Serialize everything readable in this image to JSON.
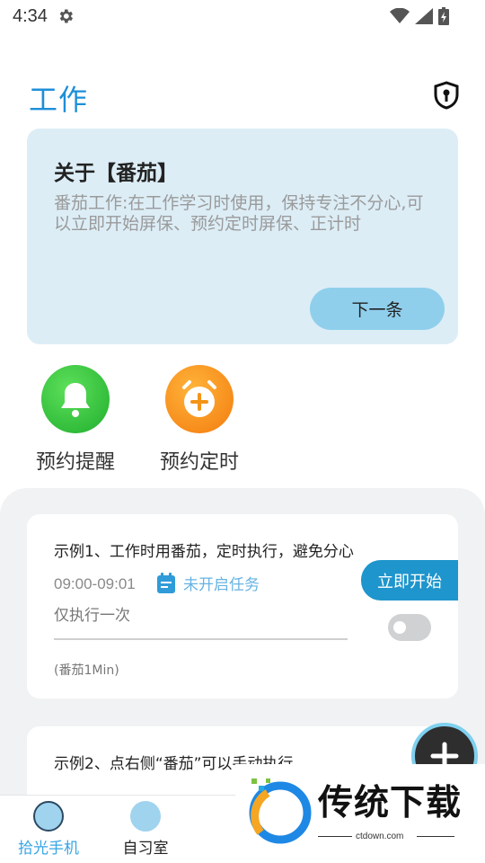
{
  "status_bar": {
    "time": "4:34"
  },
  "header": {
    "title": "工作"
  },
  "about": {
    "title": "关于【番茄】",
    "description": "番茄工作:在工作学习时使用，保持专注不分心,可以立即开始屏保、预约定时屏保、正计时",
    "next_label": "下一条"
  },
  "quick_actions": [
    {
      "label": "预约提醒",
      "icon": "bell-icon"
    },
    {
      "label": "预约定时",
      "icon": "alarm-clock-plus-icon"
    }
  ],
  "tasks": [
    {
      "title": "示例1、工作时用番茄，定时执行，避免分心",
      "time": "09:00-09:01",
      "status": "未开启任务",
      "frequency": "仅执行一次",
      "note": "(番茄1Min)",
      "start_label": "立即开始",
      "enabled": false
    },
    {
      "title": "示例2、点右侧“番茄”可以手动执行"
    }
  ],
  "tabs": [
    {
      "label": "拾光手机",
      "active": true
    },
    {
      "label": "自习室",
      "active": false
    },
    {
      "label": "",
      "active": false
    }
  ],
  "watermark": {
    "brand": "传统下载",
    "url": "ctdown.com"
  },
  "colors": {
    "accent": "#1d8fd8",
    "card_bg": "#dcedf6",
    "button": "#8fcfec",
    "start": "#1e95cc"
  }
}
